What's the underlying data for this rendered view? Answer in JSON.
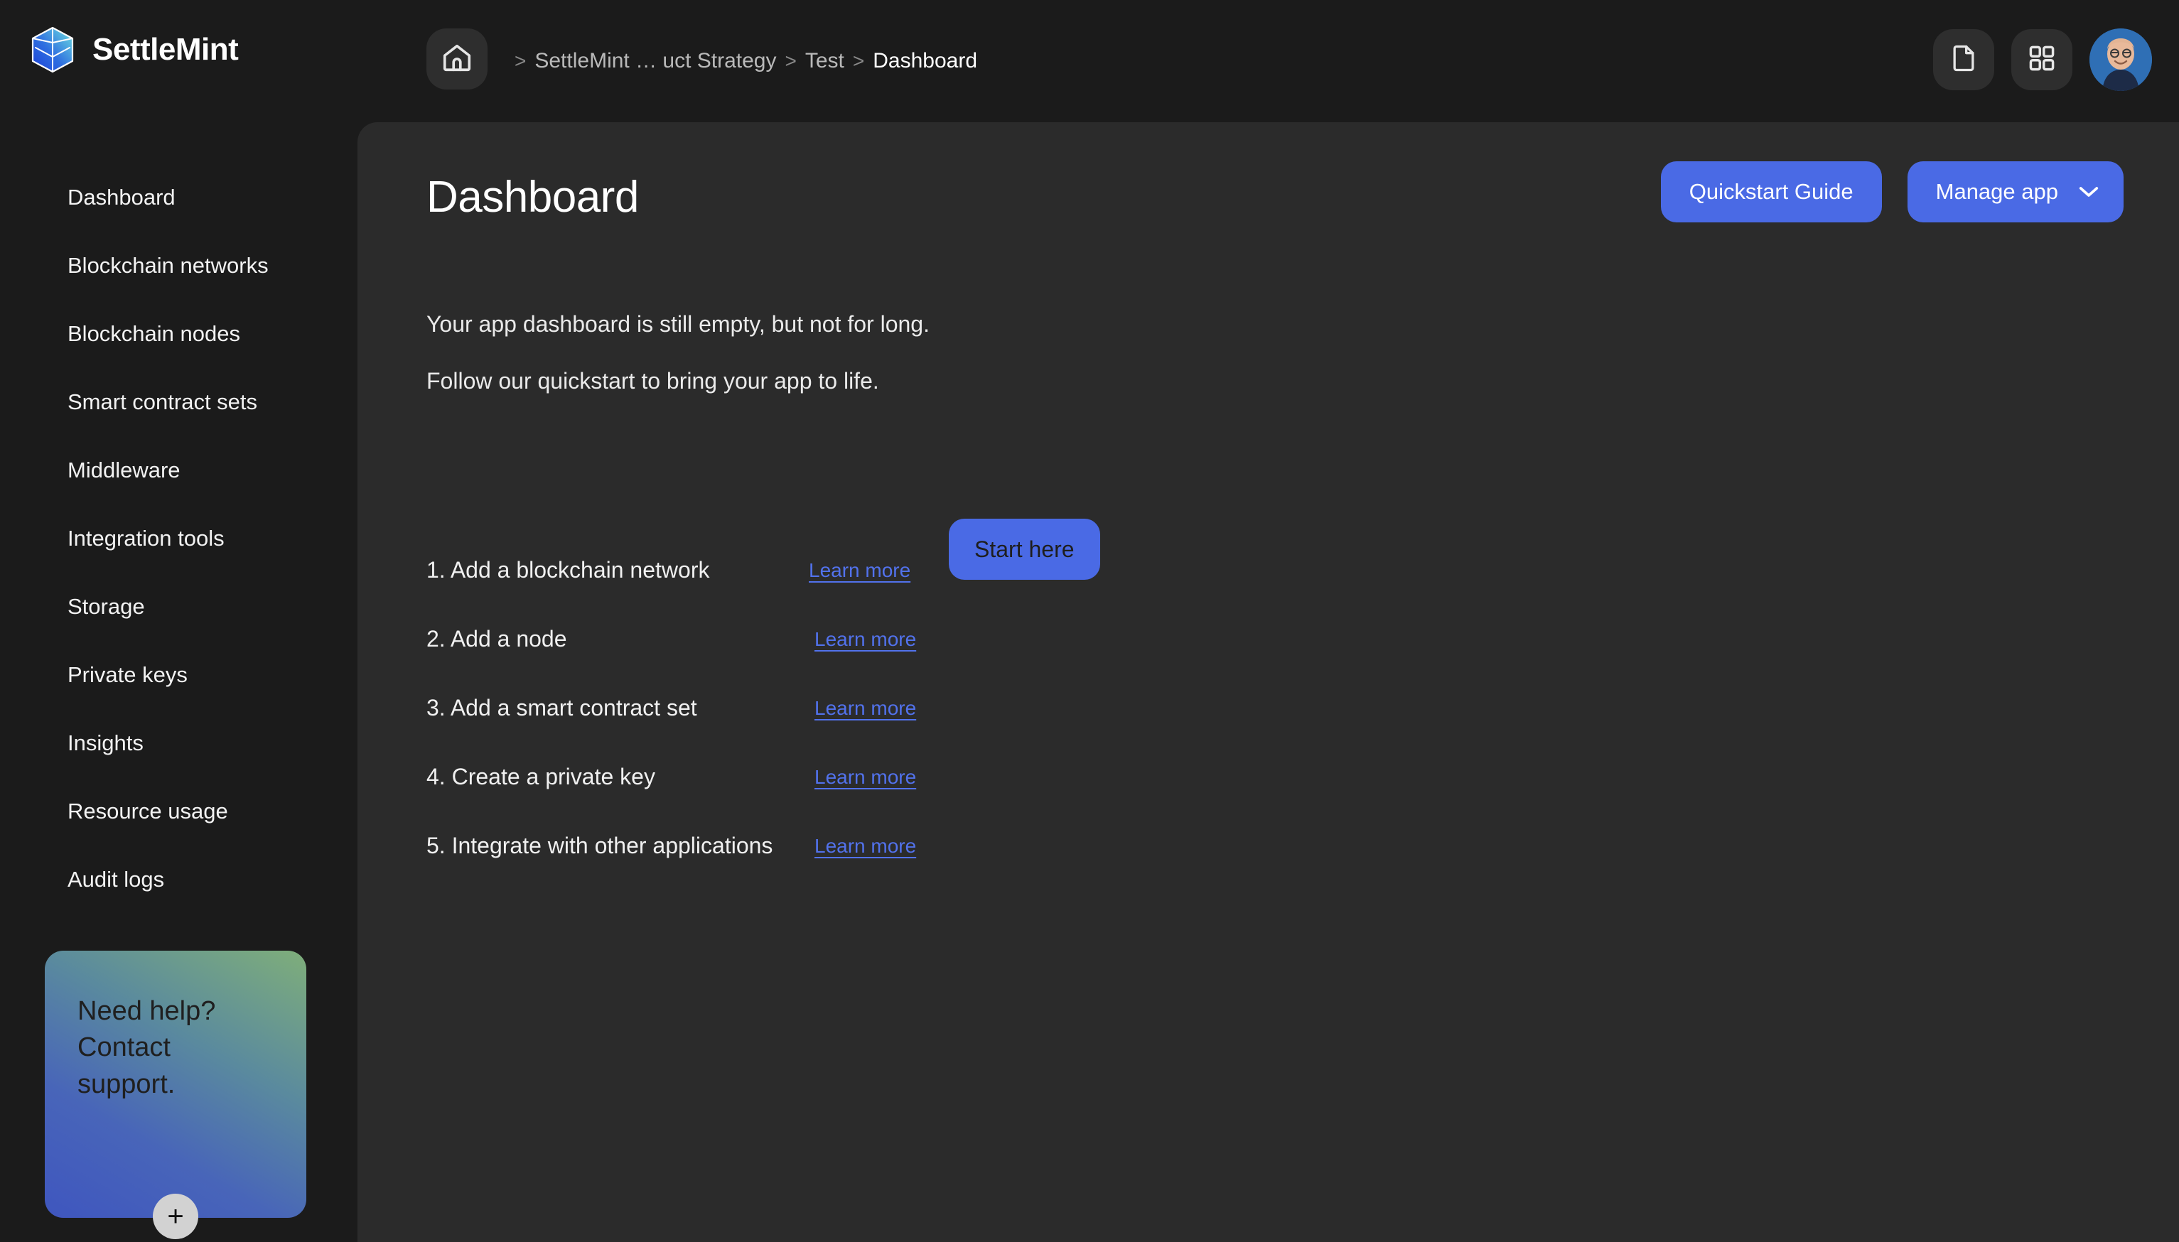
{
  "brand": {
    "name": "SettleMint",
    "logo_icon": "settlemint-cube-icon"
  },
  "topbar": {
    "home_icon": "home-icon",
    "breadcrumb": {
      "separator": ">",
      "items": [
        {
          "label": "SettleMint … uct Strategy",
          "active": false
        },
        {
          "label": "Test",
          "active": false
        },
        {
          "label": "Dashboard",
          "active": true
        }
      ]
    },
    "actions": [
      {
        "icon": "document-icon",
        "name": "documentation-button"
      },
      {
        "icon": "grid-icon",
        "name": "apps-grid-button"
      }
    ],
    "avatar_icon": "user-avatar"
  },
  "sidebar": {
    "items": [
      {
        "label": "Dashboard"
      },
      {
        "label": "Blockchain networks"
      },
      {
        "label": "Blockchain nodes"
      },
      {
        "label": "Smart contract sets"
      },
      {
        "label": "Middleware"
      },
      {
        "label": "Integration tools"
      },
      {
        "label": "Storage"
      },
      {
        "label": "Private keys"
      },
      {
        "label": "Insights"
      },
      {
        "label": "Resource usage"
      },
      {
        "label": "Audit logs"
      }
    ],
    "help_card": {
      "text": "Need help? Contact support.",
      "plus_label": "+",
      "gradient_from": "#3f56bf",
      "gradient_to": "#7fae7a"
    }
  },
  "main": {
    "title": "Dashboard",
    "actions": {
      "quickstart_label": "Quickstart Guide",
      "manage_label": "Manage app",
      "manage_caret_icon": "chevron-down-icon"
    },
    "intro": {
      "line1": "Your app dashboard is still empty, but not for long.",
      "line2": "Follow our quickstart to bring your app to life."
    },
    "steps": [
      {
        "label": "1. Add a blockchain network",
        "link": "Learn more",
        "cta": "Start here"
      },
      {
        "label": "2. Add a node",
        "link": "Learn more",
        "cta": null
      },
      {
        "label": "3. Add a smart contract set",
        "link": "Learn more",
        "cta": null
      },
      {
        "label": "4. Create a private key",
        "link": "Learn more",
        "cta": null
      },
      {
        "label": "5. Integrate with other applications",
        "link": "Learn more",
        "cta": null
      }
    ]
  },
  "colors": {
    "page_bg": "#1b1b1b",
    "panel_bg": "#2b2b2b",
    "accent_blue": "#4a6ae5",
    "link_blue": "#5272ec",
    "text_primary": "#ffffff",
    "text_muted": "#b9b9b9"
  }
}
